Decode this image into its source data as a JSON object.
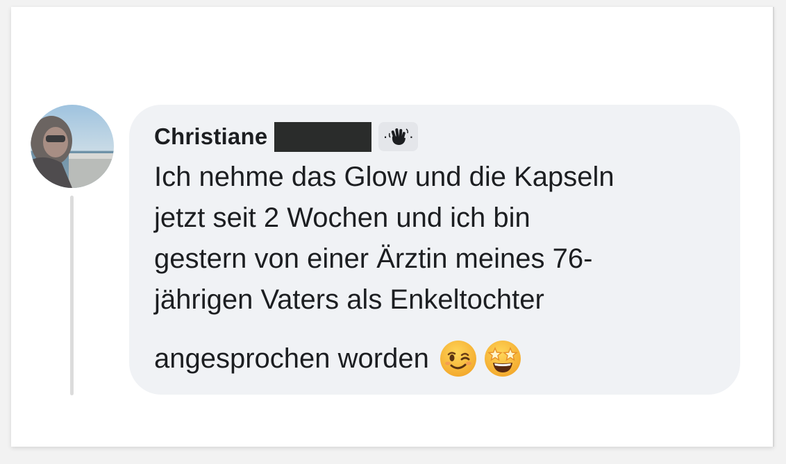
{
  "comment": {
    "author_name": "Christiane",
    "author_redacted": true,
    "badge_icon": "waving-hand-icon",
    "text_lines": [
      "Ich nehme das Glow und die Kapseln",
      "jetzt seit 2 Wochen und ich bin",
      "gestern von einer Ärztin meines 76-",
      "jährigen Vaters als Enkeltochter"
    ],
    "last_line": "angesprochen worden",
    "emojis": [
      "winking-face-icon",
      "star-struck-face-icon"
    ]
  },
  "colors": {
    "bubble": "#f0f2f5",
    "text": "#1c1e21",
    "redaction": "#2a2c2b",
    "emoji_yellow": "#f7b733"
  }
}
